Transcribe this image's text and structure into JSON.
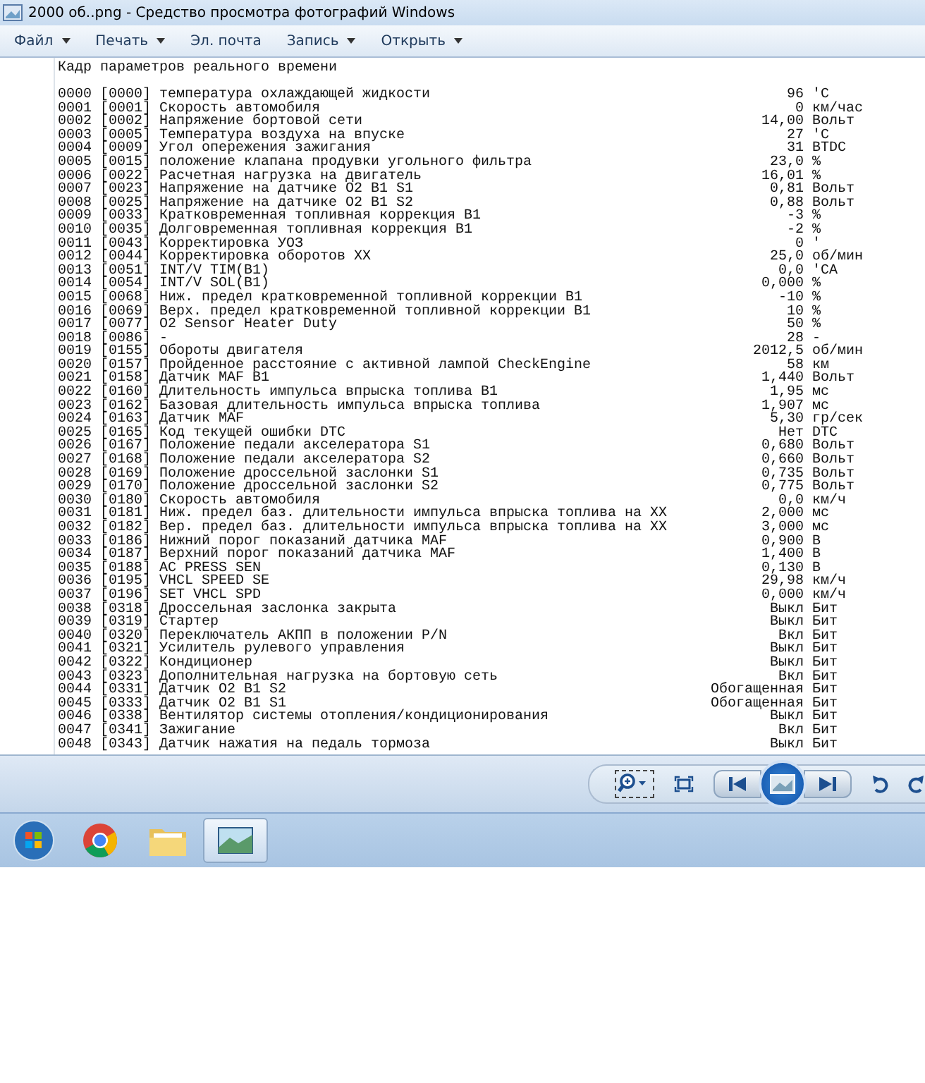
{
  "window": {
    "title": "2000 об..png - Средство просмотра фотографий Windows"
  },
  "menu": [
    {
      "label": "Файл",
      "dropdown": true
    },
    {
      "label": "Печать",
      "dropdown": true
    },
    {
      "label": "Эл. почта",
      "dropdown": false
    },
    {
      "label": "Запись",
      "dropdown": true
    },
    {
      "label": "Открыть",
      "dropdown": true
    }
  ],
  "document": {
    "heading": "Кадр параметров реального времени",
    "rows": [
      {
        "index": "0000",
        "code": "[0000]",
        "name": "температура охлаждающей жидкости",
        "value": "96",
        "unit": "'C"
      },
      {
        "index": "0001",
        "code": "[0001]",
        "name": "Скорость автомобиля",
        "value": "0",
        "unit": "км/час"
      },
      {
        "index": "0002",
        "code": "[0002]",
        "name": "Напряжение бортовой сети",
        "value": "14,00",
        "unit": "Вольт"
      },
      {
        "index": "0003",
        "code": "[0005]",
        "name": "Температура воздуха на впуске",
        "value": "27",
        "unit": "'C"
      },
      {
        "index": "0004",
        "code": "[0009]",
        "name": "Угол опережения зажигания",
        "value": "31",
        "unit": "BTDC"
      },
      {
        "index": "0005",
        "code": "[0015]",
        "name": "положение клапана продувки угольного фильтра",
        "value": "23,0",
        "unit": "%"
      },
      {
        "index": "0006",
        "code": "[0022]",
        "name": "Расчетная нагрузка на двигатель",
        "value": "16,01",
        "unit": "%"
      },
      {
        "index": "0007",
        "code": "[0023]",
        "name": "Напряжение на датчике O2 B1 S1",
        "value": "0,81",
        "unit": "Вольт"
      },
      {
        "index": "0008",
        "code": "[0025]",
        "name": "Напряжение на датчике O2 B1 S2",
        "value": "0,88",
        "unit": "Вольт"
      },
      {
        "index": "0009",
        "code": "[0033]",
        "name": "Кратковременная топливная коррекция B1",
        "value": "-3",
        "unit": "%"
      },
      {
        "index": "0010",
        "code": "[0035]",
        "name": "Долговременная топливная коррекция B1",
        "value": "-2",
        "unit": "%"
      },
      {
        "index": "0011",
        "code": "[0043]",
        "name": "Корректировка УОЗ",
        "value": "0",
        "unit": "'"
      },
      {
        "index": "0012",
        "code": "[0044]",
        "name": "Корректировка оборотов XX",
        "value": "25,0",
        "unit": "об/мин"
      },
      {
        "index": "0013",
        "code": "[0051]",
        "name": "INT/V TIM(B1)",
        "value": "0,0",
        "unit": "'CA"
      },
      {
        "index": "0014",
        "code": "[0054]",
        "name": "INT/V SOL(B1)",
        "value": "0,000",
        "unit": "%"
      },
      {
        "index": "0015",
        "code": "[0068]",
        "name": "Ниж. предел кратковременной топливной коррекции B1",
        "value": "-10",
        "unit": "%"
      },
      {
        "index": "0016",
        "code": "[0069]",
        "name": "Верх. предел кратковременной топливной коррекции B1",
        "value": "10",
        "unit": "%"
      },
      {
        "index": "0017",
        "code": "[0077]",
        "name": "O2 Sensor Heater Duty",
        "value": "50",
        "unit": "%"
      },
      {
        "index": "0018",
        "code": "[0086]",
        "name": "-",
        "value": "28",
        "unit": "-"
      },
      {
        "index": "0019",
        "code": "[0155]",
        "name": "Обороты двигателя",
        "value": "2012,5",
        "unit": "об/мин"
      },
      {
        "index": "0020",
        "code": "[0157]",
        "name": "Пройденное расстояние с активной лампой CheckEngine",
        "value": "58",
        "unit": "км"
      },
      {
        "index": "0021",
        "code": "[0158]",
        "name": "Датчик MAF B1",
        "value": "1,440",
        "unit": "Вольт"
      },
      {
        "index": "0022",
        "code": "[0160]",
        "name": "Длительность импульса впрыска топлива B1",
        "value": "1,95",
        "unit": "мс"
      },
      {
        "index": "0023",
        "code": "[0162]",
        "name": "Базовая длительность импульса впрыска топлива",
        "value": "1,907",
        "unit": "мс"
      },
      {
        "index": "0024",
        "code": "[0163]",
        "name": "Датчик MAF",
        "value": "5,30",
        "unit": "гр/сек"
      },
      {
        "index": "0025",
        "code": "[0165]",
        "name": "Код текущей ошибки DTC",
        "value": "Нет",
        "unit": "DTC"
      },
      {
        "index": "0026",
        "code": "[0167]",
        "name": "Положение педали акселератора S1",
        "value": "0,680",
        "unit": "Вольт"
      },
      {
        "index": "0027",
        "code": "[0168]",
        "name": "Положение педали акселератора S2",
        "value": "0,660",
        "unit": "Вольт"
      },
      {
        "index": "0028",
        "code": "[0169]",
        "name": "Положение дроссельной заслонки S1",
        "value": "0,735",
        "unit": "Вольт"
      },
      {
        "index": "0029",
        "code": "[0170]",
        "name": "Положение дроссельной заслонки S2",
        "value": "0,775",
        "unit": "Вольт"
      },
      {
        "index": "0030",
        "code": "[0180]",
        "name": "Скорость автомобиля",
        "value": "0,0",
        "unit": "км/ч"
      },
      {
        "index": "0031",
        "code": "[0181]",
        "name": "Ниж. предел баз. длительности импульса впрыска топлива на XX",
        "value": "2,000",
        "unit": "мс"
      },
      {
        "index": "0032",
        "code": "[0182]",
        "name": "Вер. предел баз. длительности импульса впрыска топлива на XX",
        "value": "3,000",
        "unit": "мс"
      },
      {
        "index": "0033",
        "code": "[0186]",
        "name": "Нижний порог показаний датчика MAF",
        "value": "0,900",
        "unit": "В"
      },
      {
        "index": "0034",
        "code": "[0187]",
        "name": "Верхний порог показаний датчика MAF",
        "value": "1,400",
        "unit": "В"
      },
      {
        "index": "0035",
        "code": "[0188]",
        "name": "AC PRESS SEN",
        "value": "0,130",
        "unit": "В"
      },
      {
        "index": "0036",
        "code": "[0195]",
        "name": "VHCL SPEED SE",
        "value": "29,98",
        "unit": "км/ч"
      },
      {
        "index": "0037",
        "code": "[0196]",
        "name": "SET VHCL SPD",
        "value": "0,000",
        "unit": "км/ч"
      },
      {
        "index": "0038",
        "code": "[0318]",
        "name": "Дроссельная заслонка закрыта",
        "value": "Выкл",
        "unit": "Бит"
      },
      {
        "index": "0039",
        "code": "[0319]",
        "name": "Стартер",
        "value": "Выкл",
        "unit": "Бит"
      },
      {
        "index": "0040",
        "code": "[0320]",
        "name": "Переключатель АКПП в положении P/N",
        "value": "Вкл",
        "unit": "Бит"
      },
      {
        "index": "0041",
        "code": "[0321]",
        "name": "Усилитель рулевого управления",
        "value": "Выкл",
        "unit": "Бит"
      },
      {
        "index": "0042",
        "code": "[0322]",
        "name": "Кондиционер",
        "value": "Выкл",
        "unit": "Бит"
      },
      {
        "index": "0043",
        "code": "[0323]",
        "name": "Дополнительная нагрузка на бортовую сеть",
        "value": "Вкл",
        "unit": "Бит"
      },
      {
        "index": "0044",
        "code": "[0331]",
        "name": "Датчик O2 B1 S2",
        "value": "Обогащенная",
        "unit": "Бит"
      },
      {
        "index": "0045",
        "code": "[0333]",
        "name": "Датчик O2 B1 S1",
        "value": "Обогащенная",
        "unit": "Бит"
      },
      {
        "index": "0046",
        "code": "[0338]",
        "name": "Вентилятор системы отопления/кондиционирования",
        "value": "Выкл",
        "unit": "Бит"
      },
      {
        "index": "0047",
        "code": "[0341]",
        "name": "Зажигание",
        "value": "Вкл",
        "unit": "Бит"
      },
      {
        "index": "0048",
        "code": "[0343]",
        "name": "Датчик нажатия на педаль тормоза",
        "value": "Выкл",
        "unit": "Бит"
      }
    ]
  },
  "taskbar": [
    {
      "kind": "start",
      "selected": false
    },
    {
      "kind": "browser",
      "selected": false
    },
    {
      "kind": "folder",
      "selected": false
    },
    {
      "kind": "photos",
      "selected": true
    }
  ]
}
